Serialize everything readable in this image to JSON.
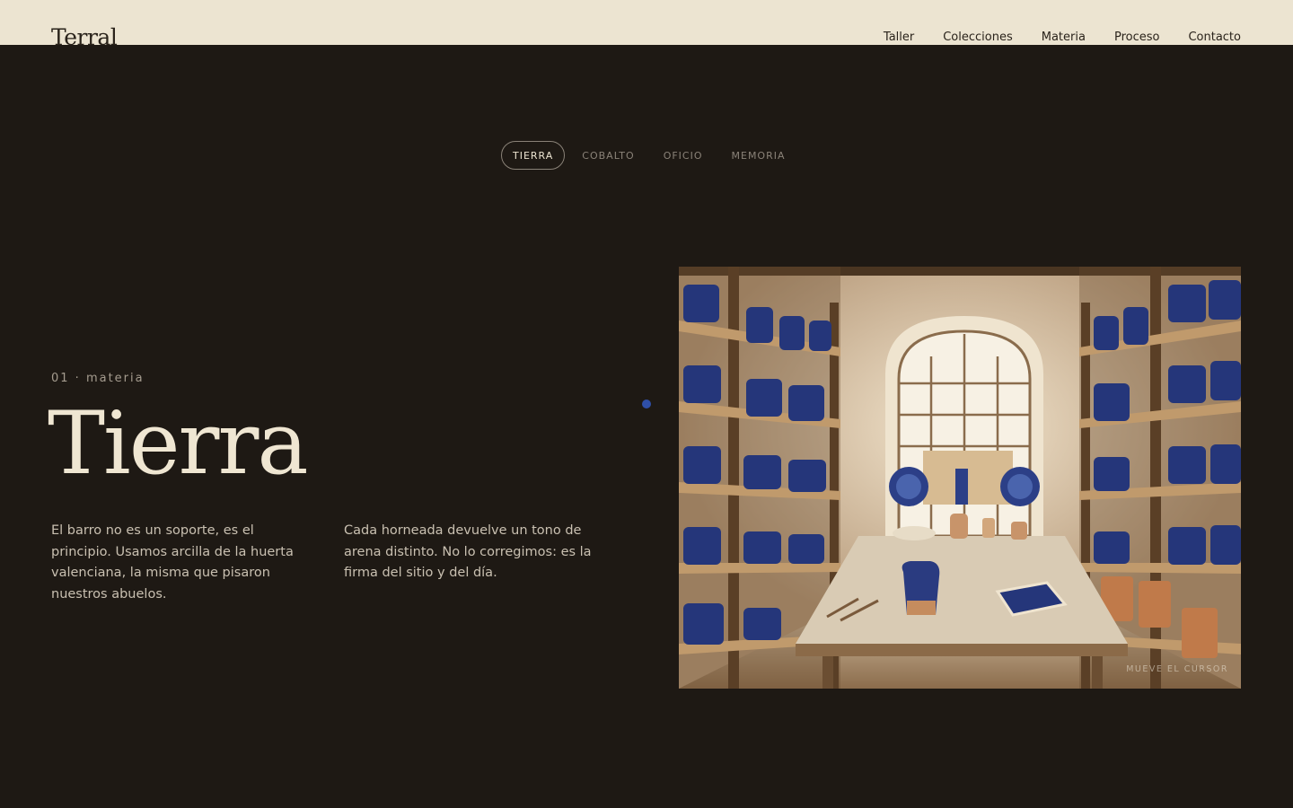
{
  "header": {
    "logo": "Terral",
    "nav": [
      "Taller",
      "Colecciones",
      "Materia",
      "Proceso",
      "Contacto"
    ]
  },
  "tabs": {
    "items": [
      "TIERRA",
      "COBALTO",
      "OFICIO",
      "MEMORIA"
    ],
    "active": "TIERRA"
  },
  "section": {
    "eyebrow": "01 · materia",
    "title": "Tierra",
    "paragraph_1": "El barro no es un soporte, es el principio. Usamos arcilla de la huerta valenciana, la misma que pisaron nuestros abuelos.",
    "paragraph_2": "Cada horneada devuelve un tono de arena distinto. No lo corregimos: es la firma del sitio y del día."
  },
  "image": {
    "hint": "MUEVE EL CURSOR"
  },
  "colors": {
    "background": "#1e1914",
    "header_bg": "#ece4d1",
    "cream_text": "#efe6d2",
    "cobalt_accent": "#2f4fa8"
  }
}
